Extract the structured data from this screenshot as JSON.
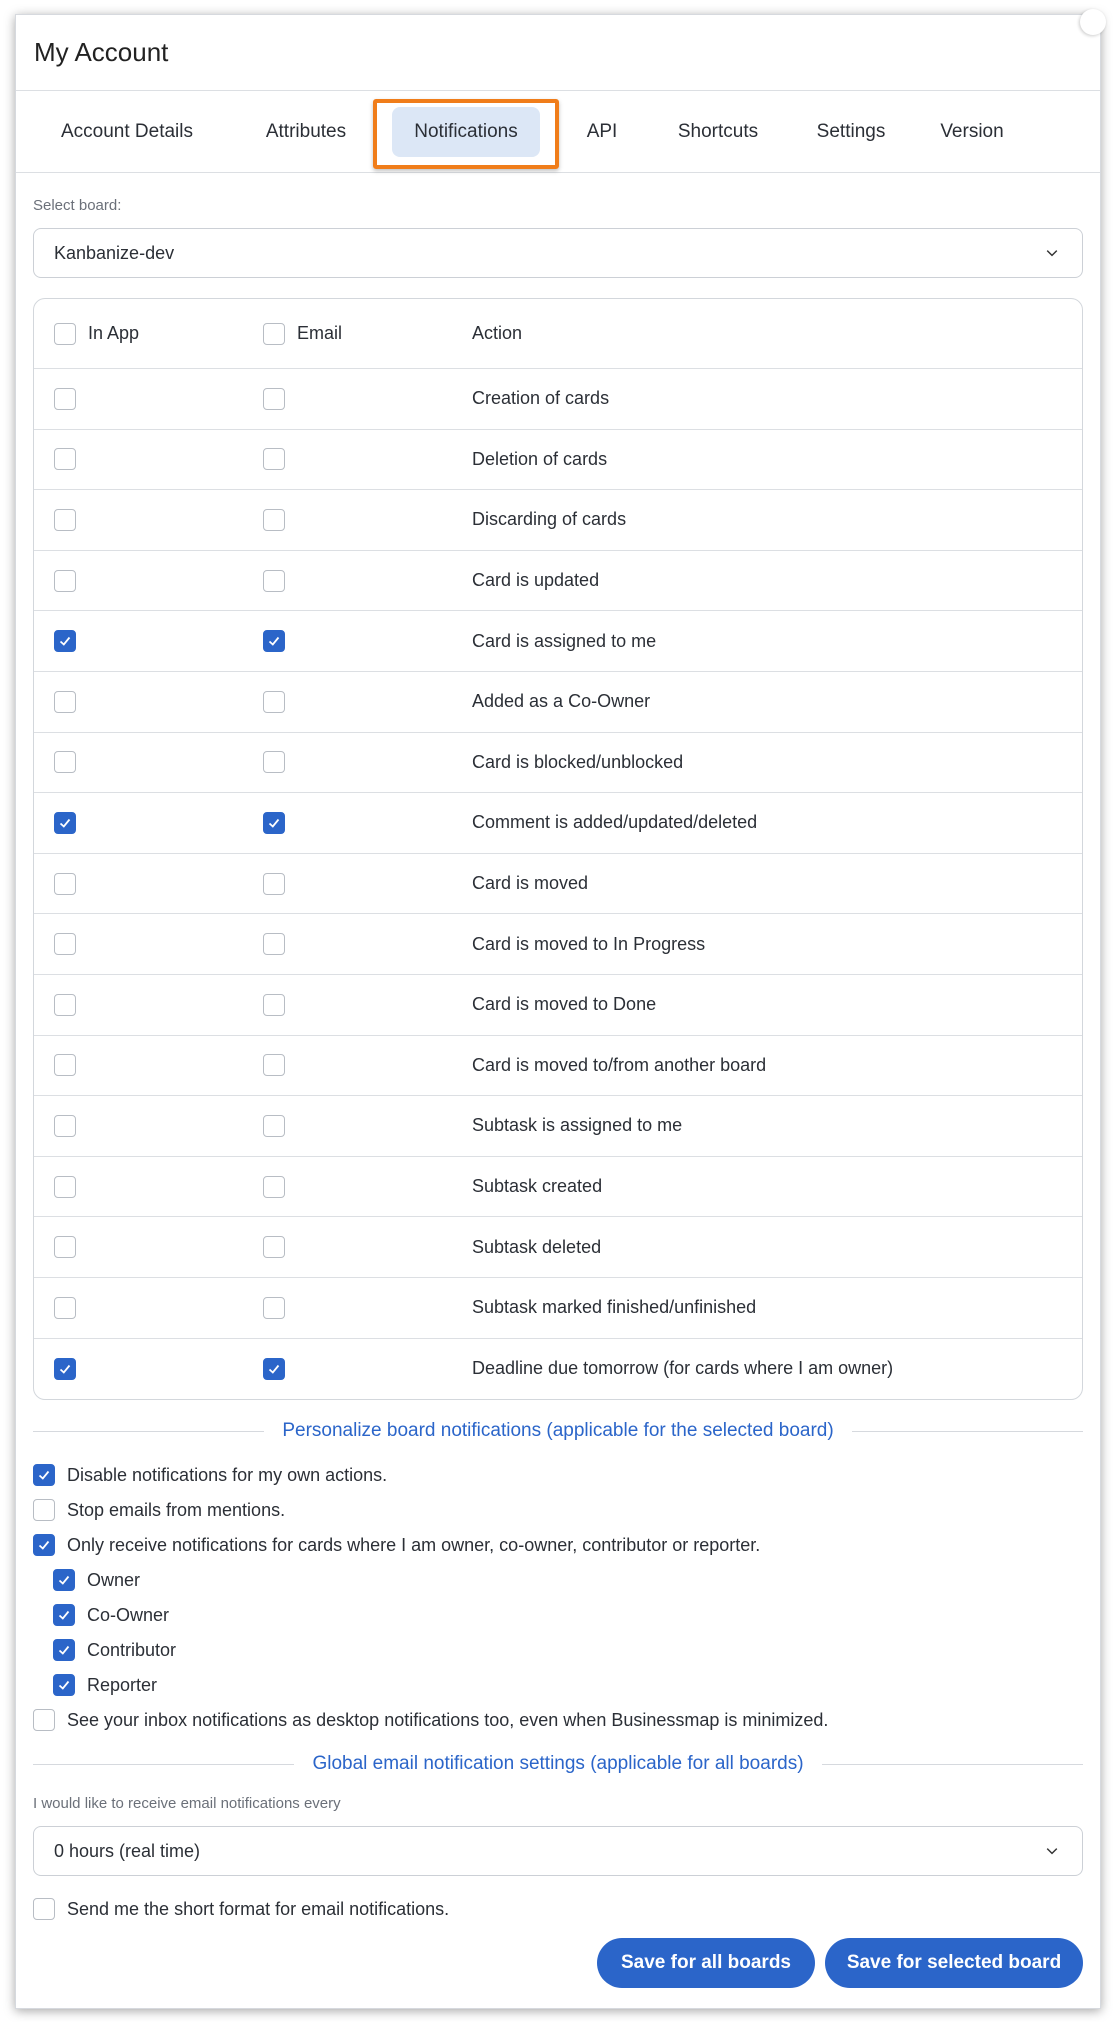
{
  "window": {
    "title": "My Account"
  },
  "tabs": [
    {
      "label": "Account Details",
      "active": false
    },
    {
      "label": "Attributes",
      "active": false
    },
    {
      "label": "Notifications",
      "active": true
    },
    {
      "label": "API",
      "active": false
    },
    {
      "label": "Shortcuts",
      "active": false
    },
    {
      "label": "Settings",
      "active": false
    },
    {
      "label": "Version",
      "active": false
    }
  ],
  "board_select": {
    "label": "Select board:",
    "value": "Kanbanize-dev"
  },
  "table": {
    "headers": {
      "in_app": "In App",
      "email": "Email",
      "action": "Action"
    },
    "rows": [
      {
        "action": "Creation of cards",
        "in_app": false,
        "email": false
      },
      {
        "action": "Deletion of cards",
        "in_app": false,
        "email": false
      },
      {
        "action": "Discarding of cards",
        "in_app": false,
        "email": false
      },
      {
        "action": "Card is updated",
        "in_app": false,
        "email": false
      },
      {
        "action": "Card is assigned to me",
        "in_app": true,
        "email": true
      },
      {
        "action": "Added as a Co-Owner",
        "in_app": false,
        "email": false
      },
      {
        "action": "Card is blocked/unblocked",
        "in_app": false,
        "email": false
      },
      {
        "action": "Comment is added/updated/deleted",
        "in_app": true,
        "email": true
      },
      {
        "action": "Card is moved",
        "in_app": false,
        "email": false
      },
      {
        "action": "Card is moved to In Progress",
        "in_app": false,
        "email": false
      },
      {
        "action": "Card is moved to Done",
        "in_app": false,
        "email": false
      },
      {
        "action": "Card is moved to/from another board",
        "in_app": false,
        "email": false
      },
      {
        "action": "Subtask is assigned to me",
        "in_app": false,
        "email": false
      },
      {
        "action": "Subtask created",
        "in_app": false,
        "email": false
      },
      {
        "action": "Subtask deleted",
        "in_app": false,
        "email": false
      },
      {
        "action": "Subtask marked finished/unfinished",
        "in_app": false,
        "email": false
      },
      {
        "action": "Deadline due tomorrow (for cards where I am owner)",
        "in_app": true,
        "email": true
      }
    ]
  },
  "personalize": {
    "title": "Personalize board notifications (applicable for the selected board)",
    "options": [
      {
        "label": "Disable notifications for my own actions.",
        "checked": true,
        "indent": false
      },
      {
        "label": "Stop emails from mentions.",
        "checked": false,
        "indent": false
      },
      {
        "label": "Only receive notifications for cards where I am owner, co-owner, contributor or reporter.",
        "checked": true,
        "indent": false
      },
      {
        "label": "Owner",
        "checked": true,
        "indent": true
      },
      {
        "label": "Co-Owner",
        "checked": true,
        "indent": true
      },
      {
        "label": "Contributor",
        "checked": true,
        "indent": true
      },
      {
        "label": "Reporter",
        "checked": true,
        "indent": true
      },
      {
        "label": "See your inbox notifications as desktop notifications too, even when Businessmap is minimized.",
        "checked": false,
        "indent": false
      }
    ]
  },
  "global": {
    "title": "Global email notification settings (applicable for all boards)",
    "frequency_label": "I would like to receive email notifications every",
    "frequency_value": "0 hours (real time)",
    "short_format": {
      "label": "Send me the short format for email notifications.",
      "checked": false
    }
  },
  "buttons": {
    "save_all": "Save for all boards",
    "save_selected": "Save for selected board"
  },
  "colors": {
    "accent": "#2b65c9",
    "highlight": "#f07d1a",
    "active_tab_bg": "#dce7f6"
  }
}
